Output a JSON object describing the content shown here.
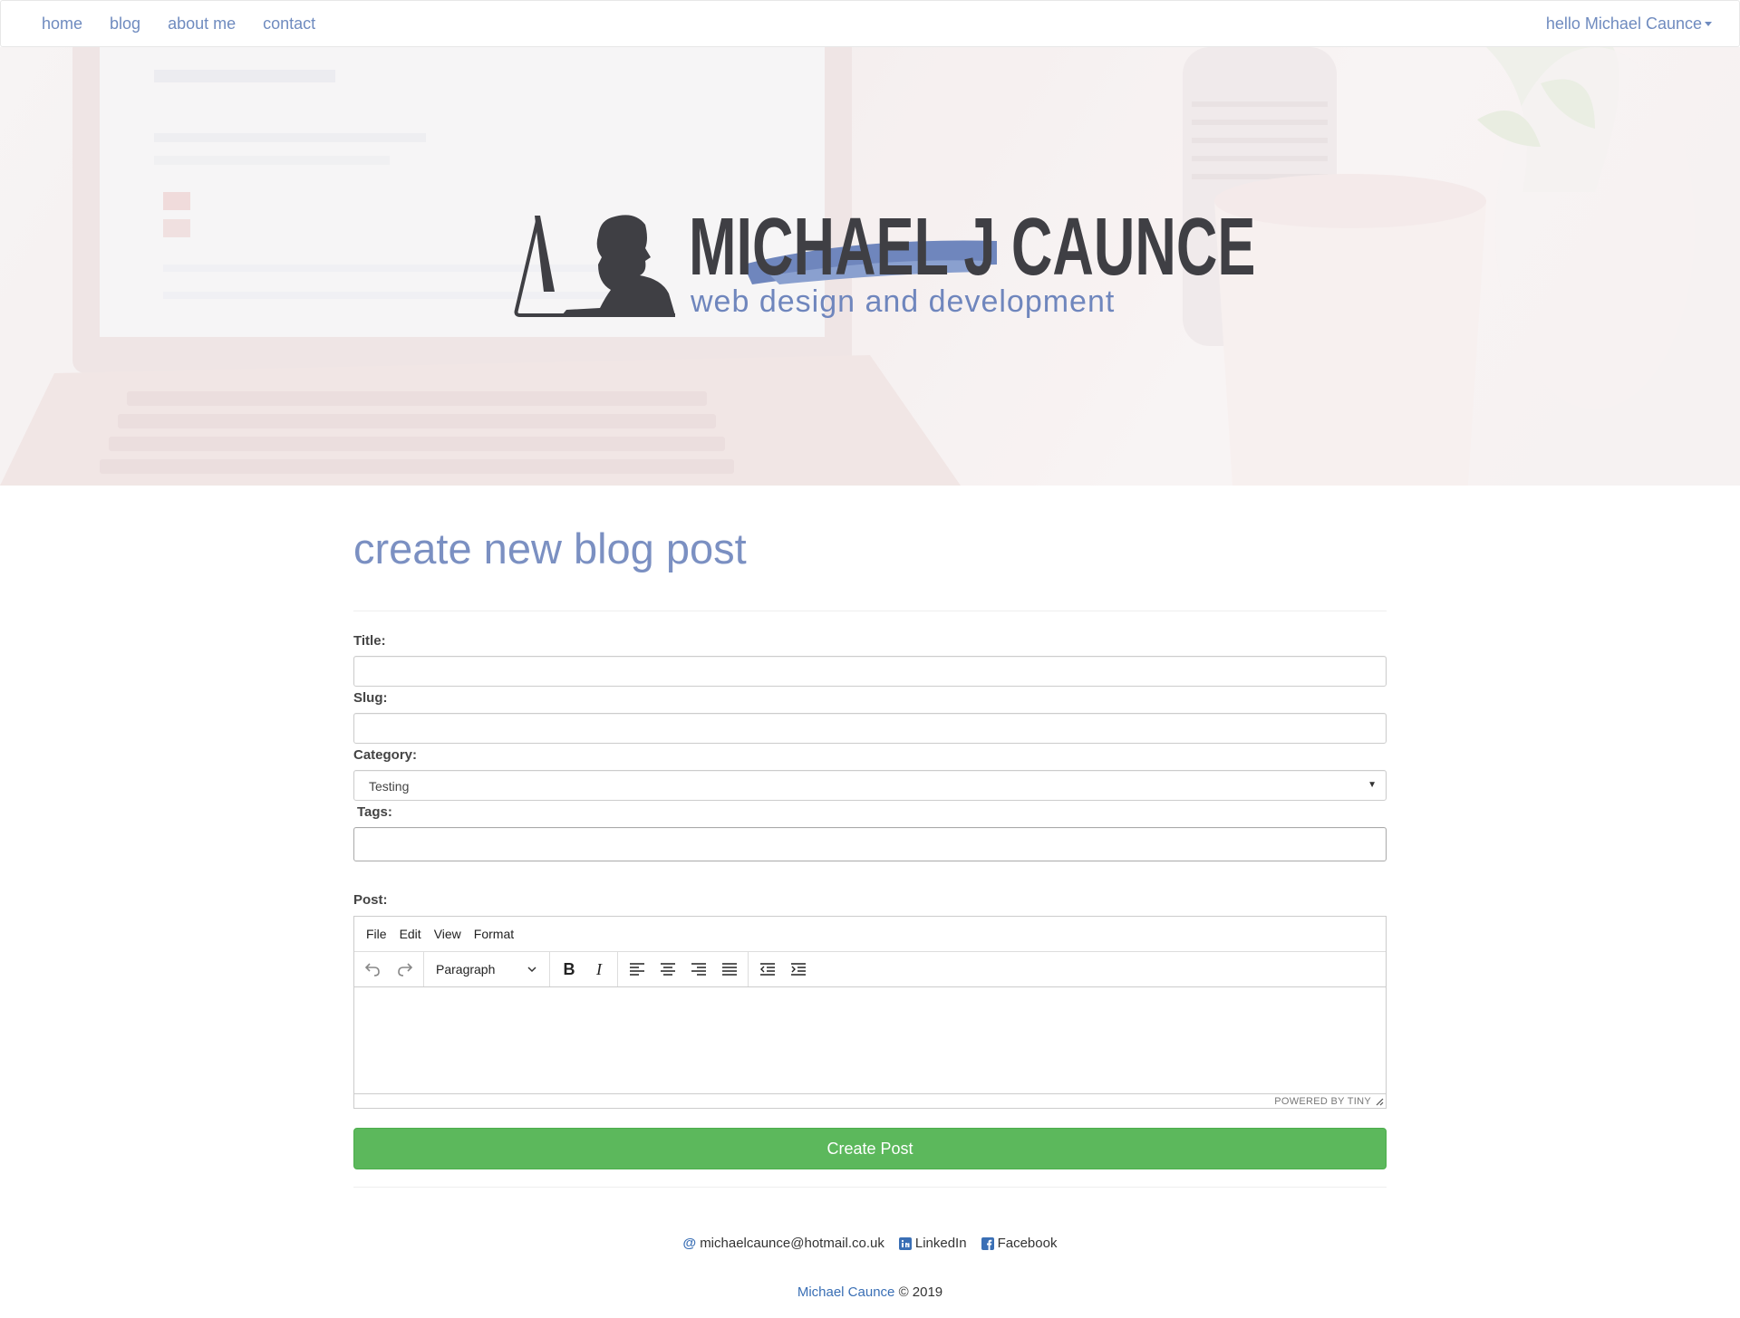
{
  "nav": {
    "items": [
      {
        "label": "home"
      },
      {
        "label": "blog"
      },
      {
        "label": "about me"
      },
      {
        "label": "contact"
      }
    ],
    "user_menu": "hello Michael Caunce"
  },
  "hero": {
    "brand_name": "MICHAEL J CAUNCE",
    "brand_tagline": "web design and development"
  },
  "page": {
    "title": "create new blog post"
  },
  "form": {
    "title_label": "Title:",
    "title_value": "",
    "slug_label": "Slug:",
    "slug_value": "",
    "category_label": "Category:",
    "category_value": "Testing",
    "tags_label": "Tags:",
    "tags_value": "",
    "post_label": "Post:",
    "submit_label": "Create Post"
  },
  "editor": {
    "menu": [
      "File",
      "Edit",
      "View",
      "Format"
    ],
    "block_format": "Paragraph",
    "powered_by": "POWERED BY TINY"
  },
  "footer": {
    "email": "michaelcaunce@hotmail.co.uk",
    "linkedin": "LinkedIn",
    "facebook": "Facebook",
    "copyright_name": "Michael Caunce",
    "copyright_year": "© 2019"
  },
  "colors": {
    "accent": "#7b90c2",
    "nav_link": "#6f8bbf",
    "success": "#5cb85c",
    "brand_dark": "#3f3f44",
    "brand_stroke": "#6f86bd"
  }
}
